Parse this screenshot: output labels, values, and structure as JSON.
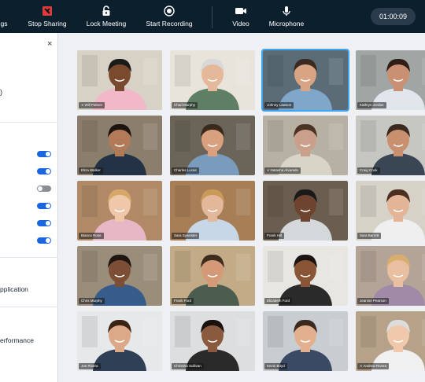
{
  "toolbar": {
    "items": [
      {
        "label": "gs",
        "icon": "settings-icon"
      },
      {
        "label": "Stop Sharing",
        "icon": "stop-sharing-icon"
      },
      {
        "label": "Lock Meeting",
        "icon": "lock-icon"
      },
      {
        "label": "Start Recording",
        "icon": "record-icon"
      },
      {
        "label": "Video",
        "icon": "video-camera-icon"
      },
      {
        "label": "Microphone",
        "icon": "microphone-icon"
      }
    ],
    "timer": "01:00:09",
    "colors": {
      "bar": "#0c1f2d",
      "stop_sharing": "#e03a3a",
      "timer_bg": "#2a3b4b"
    }
  },
  "panel": {
    "close_label": "×",
    "paren": ")",
    "toggles": [
      true,
      true,
      false,
      true,
      true,
      true
    ],
    "item_application": "pplication",
    "item_performance": "erformance",
    "colors": {
      "toggle_on": "#1a66e0",
      "toggle_off": "#8b8f95"
    }
  },
  "participants": [
    {
      "name": "Will Palmer",
      "muted": true,
      "skin": "#7a4a2e",
      "hair": "#1a1a1a",
      "shirt": "#f0b8c8",
      "bg": "#d8d2c6"
    },
    {
      "name": "Chad Murphy",
      "muted": false,
      "skin": "#e6b89a",
      "hair": "#d8d8d8",
      "shirt": "#5f7f64",
      "bg": "#e8e4dc"
    },
    {
      "name": "Johnny Lawson",
      "muted": false,
      "skin": "#d9a484",
      "hair": "#3a2a20",
      "shirt": "#7ea7c9",
      "bg": "#5b6c76",
      "active": true
    },
    {
      "name": "Kathryn Jordan",
      "muted": false,
      "skin": "#c99073",
      "hair": "#2e1e16",
      "shirt": "#e0e6ec",
      "bg": "#9fa6a4"
    },
    {
      "name": "Eliza Walker",
      "muted": false,
      "skin": "#b27a58",
      "hair": "#1d1410",
      "shirt": "#233245",
      "bg": "#8c7e6c"
    },
    {
      "name": "Charles Lucas",
      "muted": false,
      "skin": "#d8a07e",
      "hair": "#3a2a1c",
      "shirt": "#7a9cbc",
      "bg": "#6a6558"
    },
    {
      "name": "Natasha Alvarado",
      "muted": true,
      "skin": "#caa08a",
      "hair": "#4a3325",
      "shirt": "#d9d4c8",
      "bg": "#b7b1a3"
    },
    {
      "name": "Craig Cook",
      "muted": false,
      "skin": "#c99070",
      "hair": "#3a2a20",
      "shirt": "#3a4654",
      "bg": "#c7c7c2"
    },
    {
      "name": "Bianca Rose",
      "muted": false,
      "skin": "#efc8aa",
      "hair": "#d7a86a",
      "shirt": "#e7b7c6",
      "bg": "#b08a66"
    },
    {
      "name": "Sara Sylvester",
      "muted": false,
      "skin": "#e3b79a",
      "hair": "#c99a5a",
      "shirt": "#c7d7e8",
      "bg": "#a87e56"
    },
    {
      "name": "Frank Hill",
      "muted": false,
      "skin": "#6e4430",
      "hair": "#1a1a1a",
      "shirt": "#d4d8da",
      "bg": "#6b5e50"
    },
    {
      "name": "Sara Barrett",
      "muted": false,
      "skin": "#e4b496",
      "hair": "#4b3022",
      "shirt": "#efefef",
      "bg": "#d7d2c8"
    },
    {
      "name": "Chris Murphy",
      "muted": false,
      "skin": "#7b4e35",
      "hair": "#201612",
      "shirt": "#355c8a",
      "bg": "#9a8d7a"
    },
    {
      "name": "Frank Ford",
      "muted": false,
      "skin": "#d49a78",
      "hair": "#3e2c1e",
      "shirt": "#4c5c4e",
      "bg": "#c2ab86"
    },
    {
      "name": "Elizabeth Ford",
      "muted": false,
      "skin": "#8a5436",
      "hair": "#1c1410",
      "shirt": "#2a2a2a",
      "bg": "#e8e6e0"
    },
    {
      "name": "Jeanine Pearson",
      "muted": false,
      "skin": "#e9bfa2",
      "hair": "#d9ad6e",
      "shirt": "#a08aa8",
      "bg": "#b4a498"
    },
    {
      "name": "Joe Rivera",
      "muted": false,
      "skin": "#dba888",
      "hair": "#3a2416",
      "shirt": "#2f3f55",
      "bg": "#e6e8ea"
    },
    {
      "name": "Christina Sullivan",
      "muted": false,
      "skin": "#8a5a3e",
      "hair": "#1a120e",
      "shirt": "#2a2a2a",
      "bg": "#dcdedf"
    },
    {
      "name": "Kevin Boyd",
      "muted": false,
      "skin": "#e2b08e",
      "hair": "#3a2a20",
      "shirt": "#3a4a64",
      "bg": "#c7cdd1"
    },
    {
      "name": "Andrew Rivera",
      "muted": true,
      "skin": "#f0c8ac",
      "hair": "#dcdcdc",
      "shirt": "#f0f0f0",
      "bg": "#b6a289"
    }
  ]
}
